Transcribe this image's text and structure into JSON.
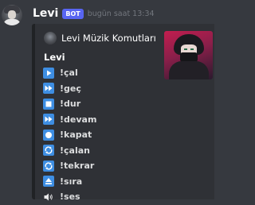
{
  "message": {
    "username": "Levi",
    "badge": "BOT",
    "timestamp": "bugün saat 13:34"
  },
  "embed": {
    "author_name": "Levi Müzik Komutları",
    "title": "Levi",
    "accent_color": "#202225",
    "commands": [
      {
        "label": "!çal",
        "icon": "play-icon"
      },
      {
        "label": "!geç",
        "icon": "fast-forward-icon"
      },
      {
        "label": "!dur",
        "icon": "stop-icon"
      },
      {
        "label": "!devam",
        "icon": "fast-forward-icon"
      },
      {
        "label": "!kapat",
        "icon": "record-button-icon"
      },
      {
        "label": "!çalan",
        "icon": "repeat-icon"
      },
      {
        "label": "!tekrar",
        "icon": "repeat-icon"
      },
      {
        "label": "!sıra",
        "icon": "eject-icon"
      },
      {
        "label": "!ses",
        "icon": "speaker-icon"
      }
    ]
  },
  "colors": {
    "background": "#36393f",
    "embed_background": "#2f3136",
    "badge": "#5865f2",
    "icon_blue": "#3e8ee2"
  }
}
